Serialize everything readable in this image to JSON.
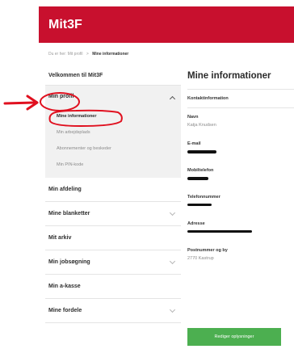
{
  "header": {
    "brand": "Mit3F"
  },
  "breadcrumb": {
    "items": [
      "Du er her:",
      "Mit profil",
      "Mine informationer"
    ]
  },
  "sidebar": {
    "welcome": "Velkommen til Mit3F",
    "profile_label": "Min profil",
    "sub_items": [
      "Mine informationer",
      "Min arbejdsplads",
      "Abonnementer og beskeder",
      "Min PIN-kode"
    ],
    "items": [
      {
        "label": "Min afdeling",
        "chevron": false
      },
      {
        "label": "Mine blanketter",
        "chevron": true
      },
      {
        "label": "Mit arkiv",
        "chevron": false
      },
      {
        "label": "Min jobsøgning",
        "chevron": true
      },
      {
        "label": "Min a-kasse",
        "chevron": false
      },
      {
        "label": "Mine fordele",
        "chevron": true
      }
    ]
  },
  "main": {
    "title": "Mine informationer",
    "section": "Kontaktinformation",
    "fields": {
      "name_label": "Navn",
      "name_value": "Katja Knudsen",
      "email_label": "E-mail",
      "mobile_label": "Mobiltelefon",
      "phone_label": "Telefonnummer",
      "address_label": "Adresse",
      "postal_label": "Postnummer og by",
      "postal_value": "2770 Kastrup"
    },
    "update_button": "Rediger oplysninger"
  },
  "colors": {
    "brand": "#c8102e",
    "button": "#4caf50",
    "annotation": "#e0101f"
  }
}
